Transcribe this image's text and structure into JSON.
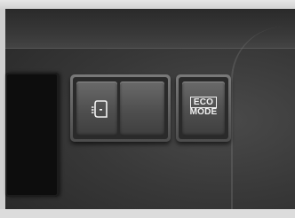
{
  "scene": {
    "description_colors": {
      "dashboard": "#383838",
      "trim": "#dcdcdc",
      "button_face": "#555555",
      "label": "#f2f2f2"
    }
  },
  "buttons": {
    "sliding_door": {
      "icon": "sliding-door-icon"
    },
    "blank": {
      "icon": ""
    },
    "eco_mode": {
      "line1": "ECO",
      "line2": "MODE"
    }
  }
}
